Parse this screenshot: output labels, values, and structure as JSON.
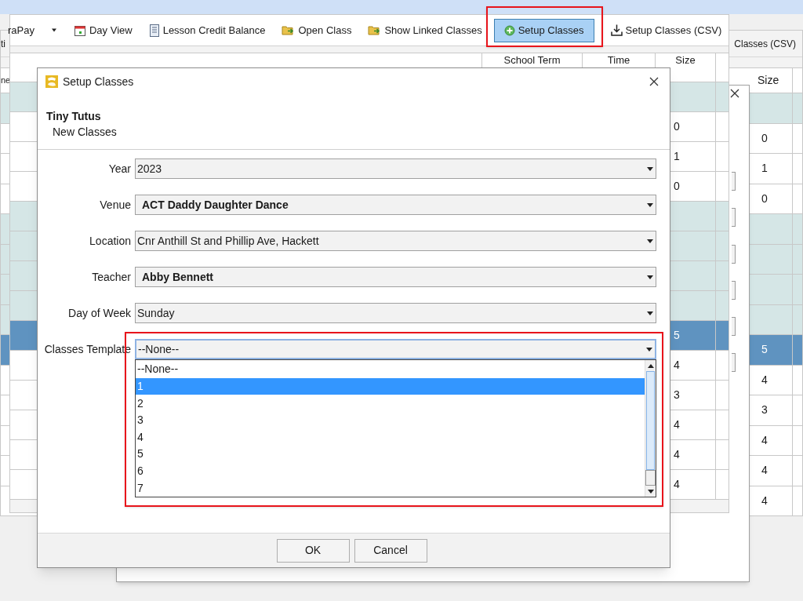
{
  "back_window": {
    "toolbar_items": [
      "ti",
      "Classes (CSV)"
    ],
    "table": {
      "columns": [
        "ne",
        "Size"
      ],
      "rows": [
        {
          "kind": "group",
          "selected": false,
          "size": ""
        },
        {
          "kind": "item",
          "selected": false,
          "size": "0"
        },
        {
          "kind": "item",
          "selected": false,
          "size": "1"
        },
        {
          "kind": "item",
          "selected": false,
          "size": "0"
        },
        {
          "kind": "group",
          "selected": false,
          "size": ""
        },
        {
          "kind": "group",
          "selected": false,
          "size": ""
        },
        {
          "kind": "group",
          "selected": false,
          "size": ""
        },
        {
          "kind": "group",
          "selected": false,
          "size": ""
        },
        {
          "kind": "item",
          "selected": true,
          "size": "5"
        },
        {
          "kind": "item",
          "selected": false,
          "size": "4"
        },
        {
          "kind": "item",
          "selected": false,
          "size": "3"
        },
        {
          "kind": "item",
          "selected": false,
          "size": "4"
        },
        {
          "kind": "item",
          "selected": false,
          "size": "4"
        },
        {
          "kind": "item",
          "selected": false,
          "size": "4"
        }
      ]
    }
  },
  "main_window": {
    "toolbar": [
      {
        "label": "raPay",
        "selected": false
      },
      {
        "selected": false
      },
      {
        "label": "Day View",
        "selected": false
      },
      {
        "label": "Lesson Credit Balance",
        "selected": false
      },
      {
        "label": "Open Class",
        "selected": false
      },
      {
        "label": "Show Linked Classes",
        "selected": false
      },
      {
        "label": "Setup Classes",
        "selected": true
      },
      {
        "label": "Setup Classes (CSV)",
        "selected": false
      }
    ],
    "table": {
      "columns": [
        "School Term",
        "Time",
        "Size"
      ],
      "rows": [
        {
          "kind": "group",
          "selected": false,
          "size": ""
        },
        {
          "kind": "item",
          "selected": false,
          "size": "0"
        },
        {
          "kind": "item",
          "selected": false,
          "size": "1"
        },
        {
          "kind": "item",
          "selected": false,
          "size": "0"
        },
        {
          "kind": "group",
          "selected": false,
          "size": ""
        },
        {
          "kind": "group",
          "selected": false,
          "size": ""
        },
        {
          "kind": "group",
          "selected": false,
          "size": ""
        },
        {
          "kind": "group",
          "selected": false,
          "size": ""
        },
        {
          "kind": "item",
          "selected": true,
          "size": "5"
        },
        {
          "kind": "item",
          "selected": false,
          "size": "4"
        },
        {
          "kind": "item",
          "selected": false,
          "size": "3"
        },
        {
          "kind": "item",
          "selected": false,
          "size": "4"
        },
        {
          "kind": "item",
          "selected": false,
          "size": "4"
        },
        {
          "kind": "item",
          "selected": false,
          "size": "4"
        }
      ]
    }
  },
  "dialog": {
    "title": "Setup Classes",
    "heading": "Tiny Tutus",
    "subheading": "New Classes",
    "fields": [
      {
        "label": "Year",
        "value": "2023",
        "bold": false,
        "expanded": false
      },
      {
        "label": "Venue",
        "value": "ACT Daddy Daughter Dance",
        "bold": true,
        "expanded": false
      },
      {
        "label": "Location",
        "value": "Cnr Anthill St and Phillip Ave, Hackett",
        "bold": false,
        "expanded": false
      },
      {
        "label": "Teacher",
        "value": "Abby Bennett",
        "bold": true,
        "expanded": false
      },
      {
        "label": "Day of Week",
        "value": "Sunday",
        "bold": false,
        "expanded": false
      },
      {
        "label": "Classes Template",
        "value": "--None--",
        "bold": false,
        "expanded": true,
        "options": [
          {
            "label": "--None--",
            "highlighted": false
          },
          {
            "label": "1",
            "highlighted": true
          },
          {
            "label": "2",
            "highlighted": false
          },
          {
            "label": "3",
            "highlighted": false
          },
          {
            "label": "4",
            "highlighted": false
          },
          {
            "label": "5",
            "highlighted": false
          },
          {
            "label": "6",
            "highlighted": false
          },
          {
            "label": "7",
            "highlighted": false
          }
        ]
      }
    ],
    "buttons": [
      "OK",
      "Cancel"
    ]
  }
}
